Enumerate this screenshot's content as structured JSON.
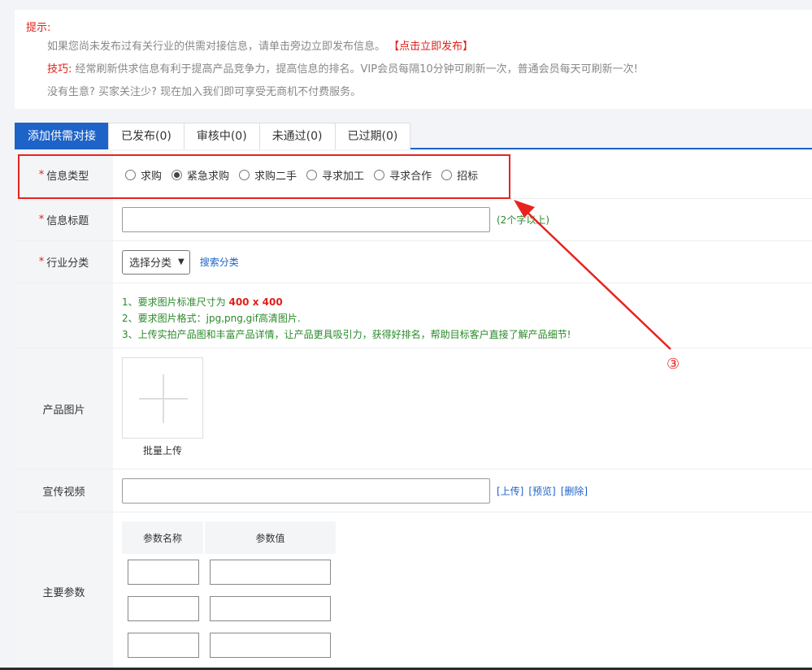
{
  "notice": {
    "title": "提示:",
    "line1": "如果您尚未发布过有关行业的供需对接信息，请单击旁边立即发布信息。",
    "line1_link": "【点击立即发布】",
    "line2_label": "技巧:",
    "line2": "经常刷新供求信息有利于提高产品竞争力，提高信息的排名。VIP会员每隔10分钟可刷新一次，普通会员每天可刷新一次!",
    "line3": "没有生意? 买家关注少? 现在加入我们即可享受无商机不付费服务。"
  },
  "tabs": [
    {
      "label": "添加供需对接",
      "active": true
    },
    {
      "label": "已发布(0)",
      "active": false
    },
    {
      "label": "审核中(0)",
      "active": false
    },
    {
      "label": "未通过(0)",
      "active": false
    },
    {
      "label": "已过期(0)",
      "active": false
    }
  ],
  "form": {
    "info_type": {
      "label": "信息类型",
      "options": [
        "求购",
        "紧急求购",
        "求购二手",
        "寻求加工",
        "寻求合作",
        "招标"
      ],
      "selected": "紧急求购"
    },
    "info_title": {
      "label": "信息标题",
      "value": "",
      "hint": "(2个字以上)"
    },
    "industry": {
      "label": "行业分类",
      "select_value": "选择分类",
      "search_link": "搜索分类"
    },
    "requirements": {
      "r1_prefix": "1、要求图片标准尺寸为",
      "r1_size": "400 x 400",
      "r2": "2、要求图片格式：jpg,png,gif高清图片.",
      "r3": "3、上传实拍产品图和丰富产品详情，让产品更具吸引力，获得好排名，帮助目标客户直接了解产品细节!"
    },
    "product_image": {
      "label": "产品图片",
      "batch_upload": "批量上传"
    },
    "video": {
      "label": "宣传视频",
      "value": "",
      "upload": "[上传]",
      "preview": "[预览]",
      "delete": "[删除]"
    },
    "params": {
      "label": "主要参数",
      "col_name": "参数名称",
      "col_value": "参数值",
      "rows": [
        {
          "name": "",
          "value": ""
        },
        {
          "name": "",
          "value": ""
        },
        {
          "name": "",
          "value": ""
        }
      ]
    }
  },
  "annotation": {
    "number": "③",
    "color": "#e8231f"
  },
  "colors": {
    "accent_blue": "#1e63c8",
    "alert_red": "#e0201a",
    "hint_green": "#2a8a2a"
  }
}
